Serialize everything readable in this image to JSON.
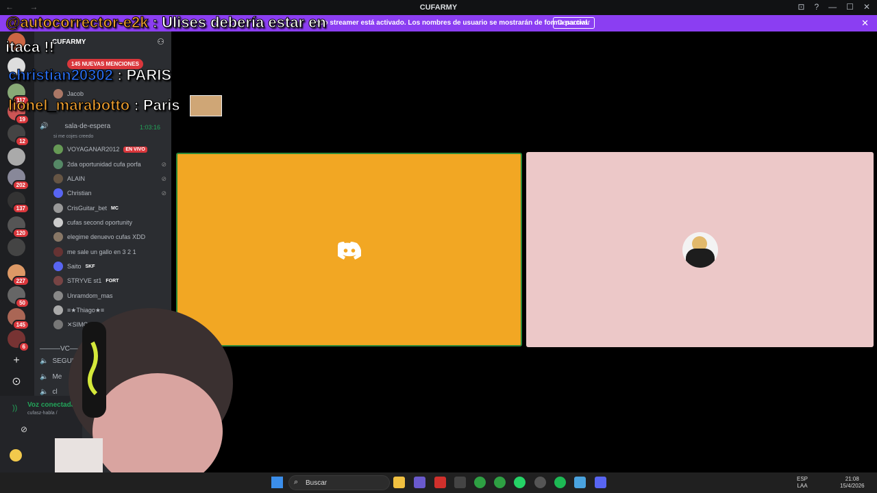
{
  "window": {
    "title": "CUFARMY",
    "nav": "← →",
    "controls": [
      "⊡",
      "?",
      "—",
      "☐",
      "✕"
    ]
  },
  "banner": {
    "text": "Modo streamer está activado. Los nombres de usuario se mostrarán de forma parcial.",
    "button": "Desactivar",
    "close": "✕"
  },
  "chat_overlay": [
    {
      "user": "@autocorrector-e2k",
      "sep": ":",
      "message": "Ulises debería estar en"
    },
    {
      "line2": "itaca !!"
    },
    {
      "user": "christian20302",
      "sep": ":",
      "message": "PARIS"
    },
    {
      "user": "lionel_marabotto",
      "sep": ":",
      "message": "Paris"
    }
  ],
  "servers": {
    "badges": [
      "117",
      "19",
      "12",
      "202",
      "137",
      "120",
      "227",
      "50",
      "145",
      "6"
    ],
    "add_icon": "+",
    "explore_icon": "⊙"
  },
  "sidebar": {
    "guild": "CUFARMY",
    "mentions": "145 NUEVAS MENCIONES",
    "members_top": [
      "Jacob"
    ],
    "voice_channel": "sala-de-espera",
    "voice_timer": "1:03:16",
    "voice_status": "si me cojes creedo",
    "members": [
      {
        "name": "VOYAGANAR2012",
        "badge": "EN VIVO"
      },
      {
        "name": "2da oportunidad cufa porfa",
        "badge": ""
      },
      {
        "name": "ALAIN",
        "badge": ""
      },
      {
        "name": "Christian",
        "badge": ""
      },
      {
        "name": "CrisGuitar_bet",
        "badge": "MC"
      },
      {
        "name": "cufas second oportunity",
        "badge": ""
      },
      {
        "name": "elegime denuevo cufas XDD",
        "badge": ""
      },
      {
        "name": "me sale un gallo en 3 2 1",
        "badge": ""
      },
      {
        "name": "Saito",
        "badge": "SKF"
      },
      {
        "name": "STRYVE st1",
        "badge": "FORT"
      },
      {
        "name": "Unramdom_mas",
        "badge": ""
      },
      {
        "name": "≡★Thiago★≡",
        "badge": ""
      },
      {
        "name": "✕SIMO_✕",
        "badge": ""
      }
    ],
    "divider": "———VC———",
    "channels": [
      "SEGUIDO",
      "Me",
      "cl"
    ]
  },
  "user_panel": {
    "voice": "Voz conectada",
    "voice_channel": "cufasz-habla /"
  },
  "taskbar": {
    "search": "Buscar",
    "lang": "ESP",
    "lang2": "LAA",
    "time": "21:08",
    "date": "15/4/2026"
  },
  "colors": {
    "tile_left": "#f2a723",
    "tile_right": "#ecc8c8",
    "banner": "#8b3ef2",
    "mention_badge": "#da373c"
  }
}
